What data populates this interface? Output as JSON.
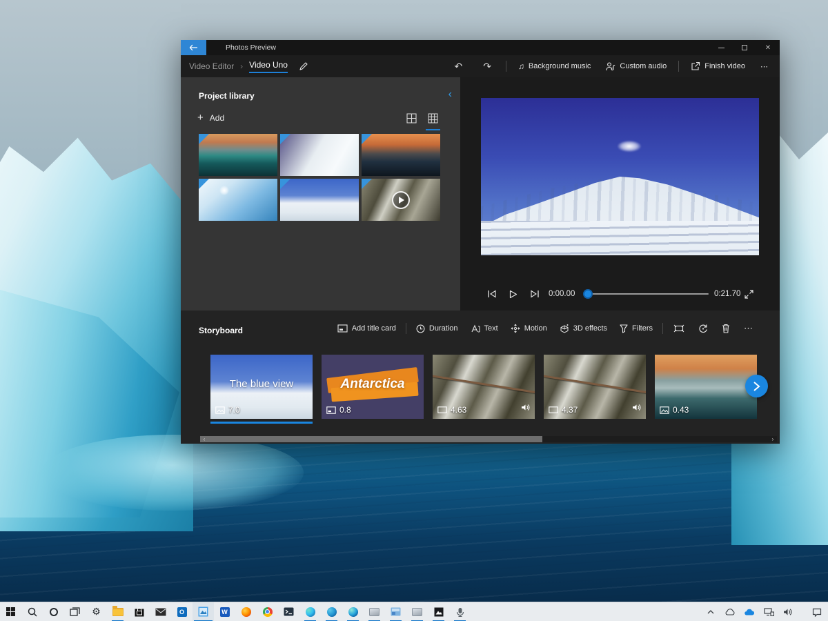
{
  "app": {
    "titlebar": {
      "title": "Photos Preview"
    },
    "breadcrumb": {
      "root": "Video Editor",
      "current": "Video Uno"
    },
    "actions": {
      "background_music": "Background music",
      "custom_audio": "Custom audio",
      "finish_video": "Finish video"
    },
    "library": {
      "title": "Project library",
      "add": "Add",
      "thumbnails": [
        {
          "name": "iceberg-sunset-teal",
          "type": "image",
          "selected": true
        },
        {
          "name": "iceberg-closeup",
          "type": "image",
          "selected": true
        },
        {
          "name": "iceberg-sunset-dark",
          "type": "image",
          "selected": true
        },
        {
          "name": "iceberg-blue-slope",
          "type": "image",
          "selected": true
        },
        {
          "name": "snow-mountain",
          "type": "image",
          "selected": true
        },
        {
          "name": "rocky-waterfall",
          "type": "video",
          "selected": true
        }
      ]
    },
    "player": {
      "current_time": "0:00.00",
      "total_time": "0:21.70"
    },
    "storyboard": {
      "title": "Storyboard",
      "toolbar": {
        "add_title_card": "Add title card",
        "duration": "Duration",
        "text": "Text",
        "motion": "Motion",
        "effects_3d": "3D effects",
        "filters": "Filters"
      },
      "clips": [
        {
          "caption": "The blue view",
          "duration": "7.0",
          "type": "image",
          "selected": true
        },
        {
          "caption": "Antarctica",
          "duration": "0.8",
          "type": "title-card",
          "selected": false
        },
        {
          "duration": "4.63",
          "type": "video",
          "has_audio": true,
          "selected": false
        },
        {
          "duration": "4.37",
          "type": "video",
          "has_audio": true,
          "selected": false
        },
        {
          "duration": "0.43",
          "type": "image",
          "selected": false
        }
      ]
    }
  },
  "desktop": {
    "taskbar_icons": [
      "start",
      "search",
      "cortana",
      "task-view",
      "settings",
      "file-explorer",
      "store",
      "mail",
      "outlook",
      "photos",
      "word",
      "firefox",
      "chrome",
      "terminal",
      "edge",
      "edge-beta",
      "edge-canary",
      "app-generic-1",
      "app-window",
      "app-generic-2",
      "photos-legacy",
      "feedback-mic"
    ],
    "tray_icons": [
      "tray-expand",
      "onedrive-cloud",
      "onedrive-cloud-blue",
      "display-network",
      "volume",
      "action-center"
    ]
  },
  "colors": {
    "accent": "#1a86e0",
    "back_button": "#2e86d5",
    "taskbar_bg": "#e9ecef",
    "window_bg": "#1e1e1e"
  }
}
